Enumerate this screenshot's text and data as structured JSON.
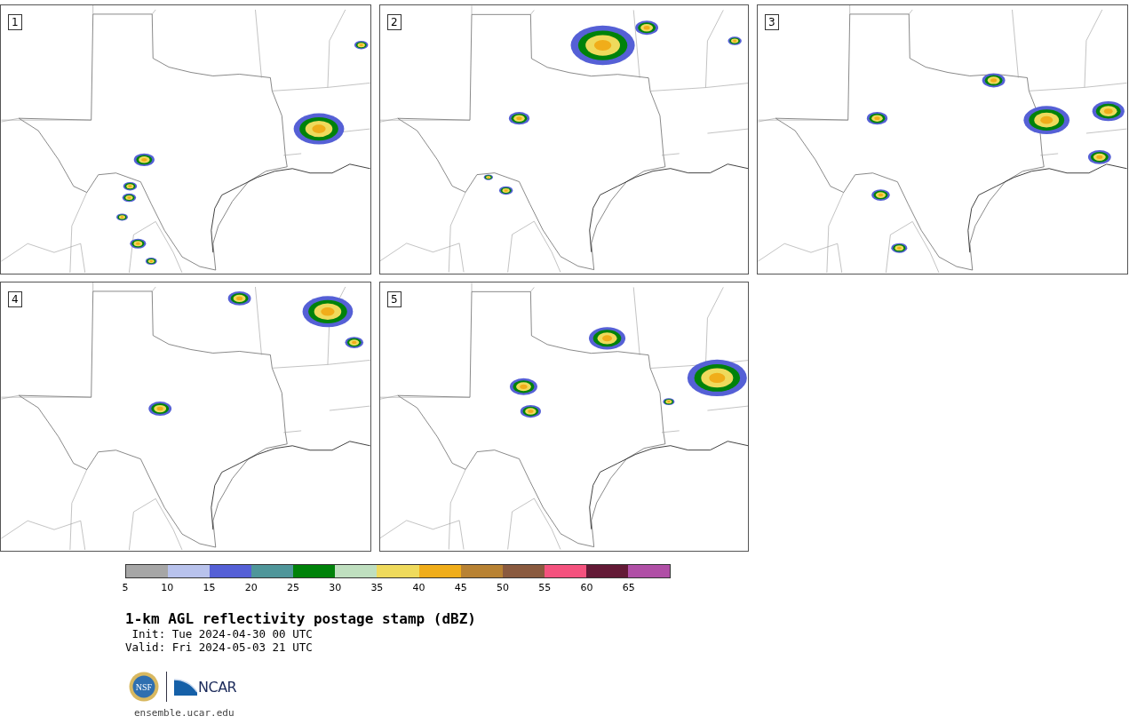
{
  "panels": [
    {
      "label": "1"
    },
    {
      "label": "2"
    },
    {
      "label": "3"
    },
    {
      "label": "4"
    },
    {
      "label": "5"
    }
  ],
  "colorbar": {
    "segments": [
      {
        "color": "#a6a6a6"
      },
      {
        "color": "#b8c2ec"
      },
      {
        "color": "#5560d6"
      },
      {
        "color": "#4f969a"
      },
      {
        "color": "#00820a"
      },
      {
        "color": "#bfdfbf"
      },
      {
        "color": "#efda5c"
      },
      {
        "color": "#f0ad1a"
      },
      {
        "color": "#b88233"
      },
      {
        "color": "#8a5a3f"
      },
      {
        "color": "#f4527e"
      },
      {
        "color": "#631a36"
      },
      {
        "color": "#b04fa6"
      }
    ],
    "ticks": [
      "5",
      "10",
      "15",
      "20",
      "25",
      "30",
      "35",
      "40",
      "45",
      "50",
      "55",
      "60",
      "65"
    ]
  },
  "title": "1-km AGL reflectivity postage stamp (dBZ)",
  "init": " Init: Tue 2024-04-30 00 UTC",
  "valid": "Valid: Fri 2024-05-03 21 UTC",
  "logos": [
    {
      "kind": "nsf",
      "text": "NSF"
    },
    {
      "kind": "ncar",
      "text": "NCAR"
    }
  ],
  "footer": "ensemble.ucar.edu"
}
